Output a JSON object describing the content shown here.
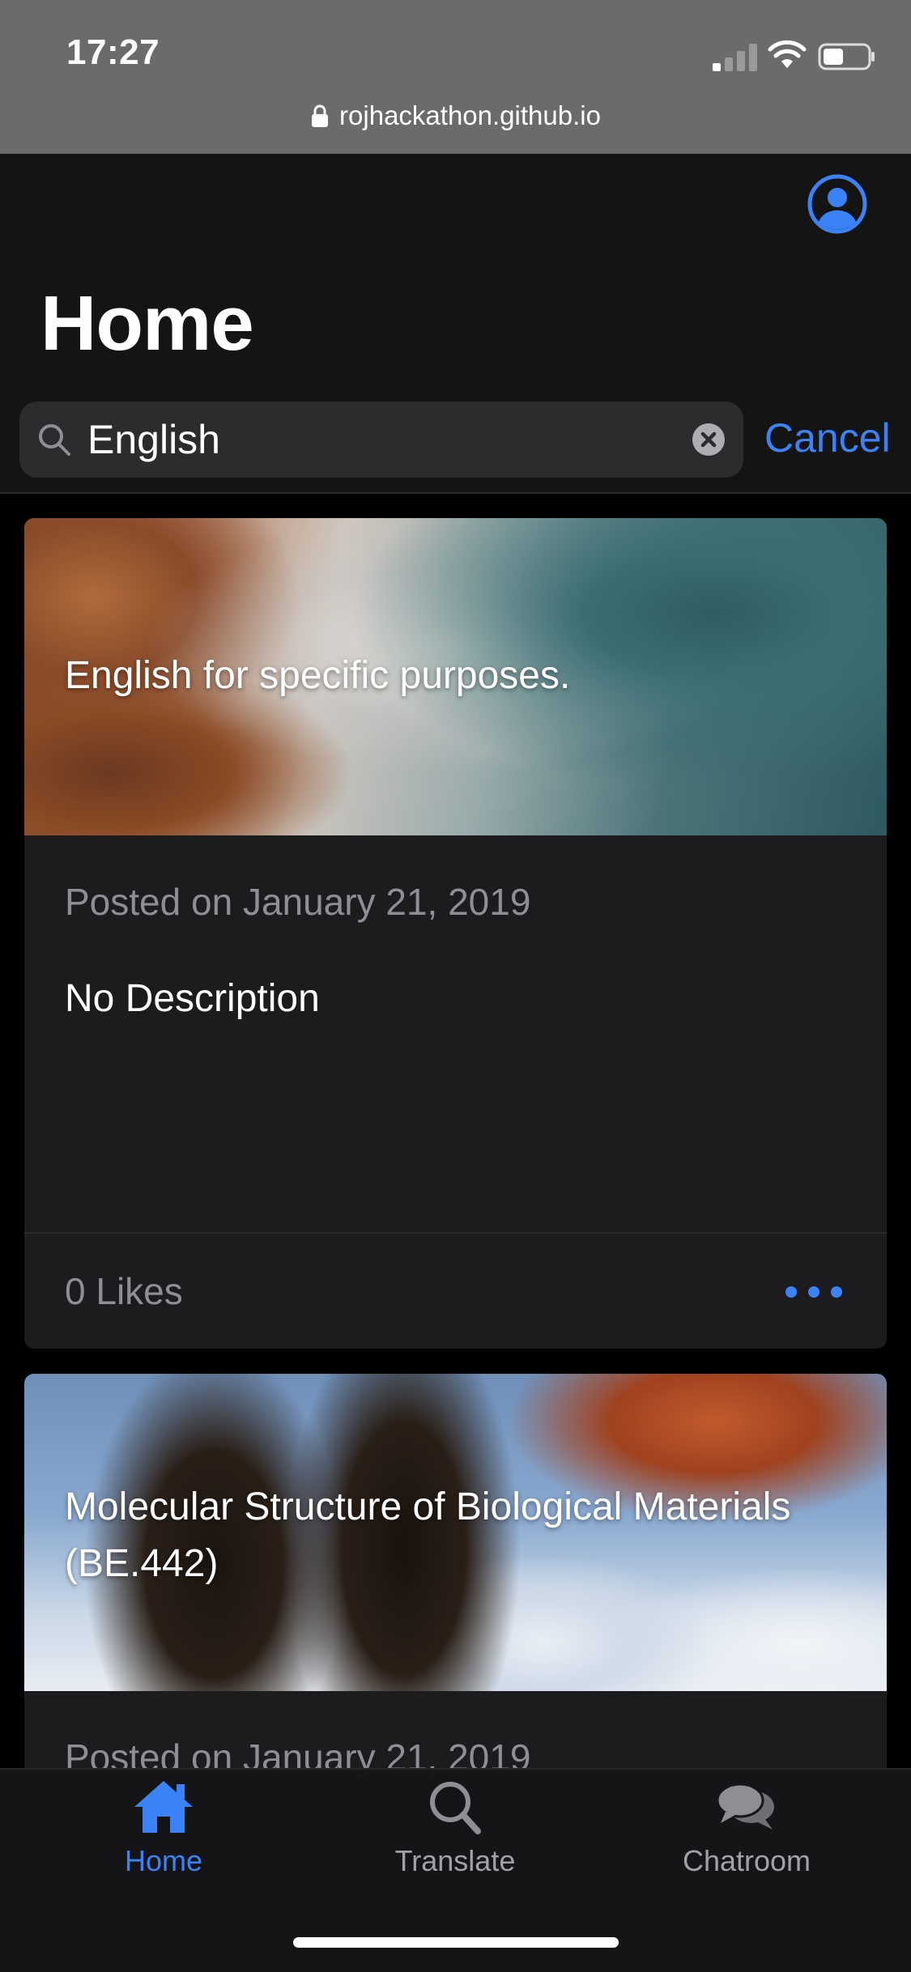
{
  "status_bar": {
    "time": "17:27",
    "url": "rojhackathon.github.io"
  },
  "header": {
    "title": "Home"
  },
  "search": {
    "value": "English",
    "cancel_label": "Cancel"
  },
  "cards": [
    {
      "image_title": "English for specific purposes.",
      "posted": "Posted on January 21, 2019",
      "description": "No Description",
      "likes": "0 Likes"
    },
    {
      "image_title": "Molecular Structure of Biological Materials (BE.442)",
      "posted": "Posted on January 21, 2019"
    }
  ],
  "tabs": [
    {
      "label": "Home",
      "icon": "home-icon",
      "active": true
    },
    {
      "label": "Translate",
      "icon": "search-icon",
      "active": false
    },
    {
      "label": "Chatroom",
      "icon": "chat-bubbles-icon",
      "active": false
    }
  ],
  "colors": {
    "accent": "#3b82f6",
    "background": "#000000",
    "card": "#1c1c1e",
    "muted_text": "#8e8e93"
  }
}
